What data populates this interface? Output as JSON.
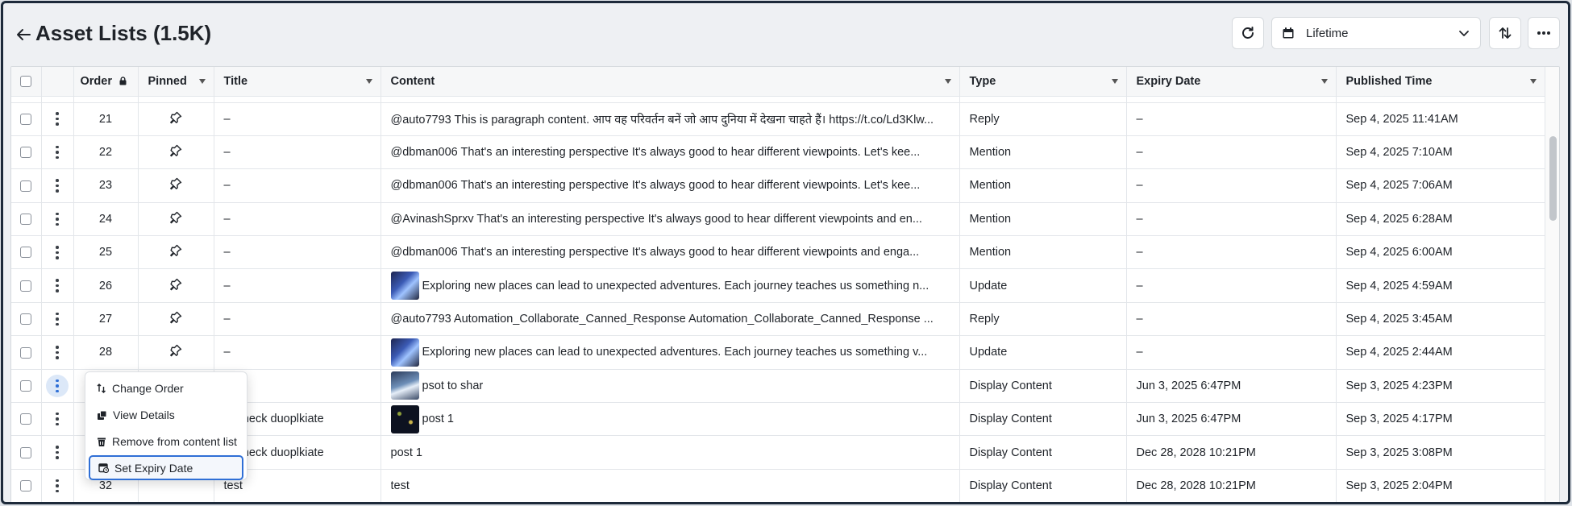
{
  "header": {
    "title": "Asset Lists (1.5K)",
    "date_range": "Lifetime"
  },
  "columns": {
    "order": "Order",
    "pinned": "Pinned",
    "title": "Title",
    "content": "Content",
    "type": "Type",
    "expiry": "Expiry Date",
    "published": "Published Time"
  },
  "rows": [
    {
      "order": "21",
      "title": "–",
      "content": "@auto7793 This is paragraph content. आप वह परिवर्तन बनें जो आप दुनिया में देखना चाहते हैं। https://t.co/Ld3Klw...",
      "type": "Reply",
      "expiry": "–",
      "published": "Sep 4, 2025 11:41AM"
    },
    {
      "order": "22",
      "title": "–",
      "content": "@dbman006 That's an interesting perspective It's always good to hear different viewpoints. Let's kee...",
      "type": "Mention",
      "expiry": "–",
      "published": "Sep 4, 2025 7:10AM"
    },
    {
      "order": "23",
      "title": "–",
      "content": "@dbman006 That's an interesting perspective It's always good to hear different viewpoints. Let's kee...",
      "type": "Mention",
      "expiry": "–",
      "published": "Sep 4, 2025 7:06AM"
    },
    {
      "order": "24",
      "title": "–",
      "content": "@AvinashSprxv That's an interesting perspective It's always good to hear different viewpoints and en...",
      "type": "Mention",
      "expiry": "–",
      "published": "Sep 4, 2025 6:28AM"
    },
    {
      "order": "25",
      "title": "–",
      "content": "@dbman006 That's an interesting perspective It's always good to hear different viewpoints and enga...",
      "type": "Mention",
      "expiry": "–",
      "published": "Sep 4, 2025 6:00AM"
    },
    {
      "order": "26",
      "title": "–",
      "content": "Exploring new places can lead to unexpected adventures. Each journey teaches us something n...",
      "type": "Update",
      "expiry": "–",
      "published": "Sep 4, 2025 4:59AM"
    },
    {
      "order": "27",
      "title": "–",
      "content": "@auto7793 Automation_Collaborate_Canned_Response Automation_Collaborate_Canned_Response ...",
      "type": "Reply",
      "expiry": "–",
      "published": "Sep 4, 2025 3:45AM"
    },
    {
      "order": "28",
      "title": "–",
      "content": "Exploring new places can lead to unexpected adventures. Each journey teaches us something v...",
      "type": "Update",
      "expiry": "–",
      "published": "Sep 4, 2025 2:44AM"
    },
    {
      "order": "",
      "title": "",
      "content": "psot to shar",
      "type": "Display Content",
      "expiry": "Jun 3, 2025 6:47PM",
      "published": "Sep 3, 2025 4:23PM"
    },
    {
      "order": "",
      "title": "to check duoplkiate",
      "content": "post 1",
      "type": "Display Content",
      "expiry": "Jun 3, 2025 6:47PM",
      "published": "Sep 3, 2025 4:17PM"
    },
    {
      "order": "",
      "title": "to check duoplkiate",
      "content": "post 1",
      "type": "Display Content",
      "expiry": "Dec 28, 2028 10:21PM",
      "published": "Sep 3, 2025 3:08PM"
    },
    {
      "order": "32",
      "title": "test",
      "content": "test",
      "type": "Display Content",
      "expiry": "Dec 28, 2028 10:21PM",
      "published": "Sep 3, 2025 2:04PM"
    }
  ],
  "context_menu": {
    "change_order": "Change Order",
    "view_details": "View Details",
    "remove": "Remove from content list",
    "set_expiry": "Set Expiry Date"
  }
}
